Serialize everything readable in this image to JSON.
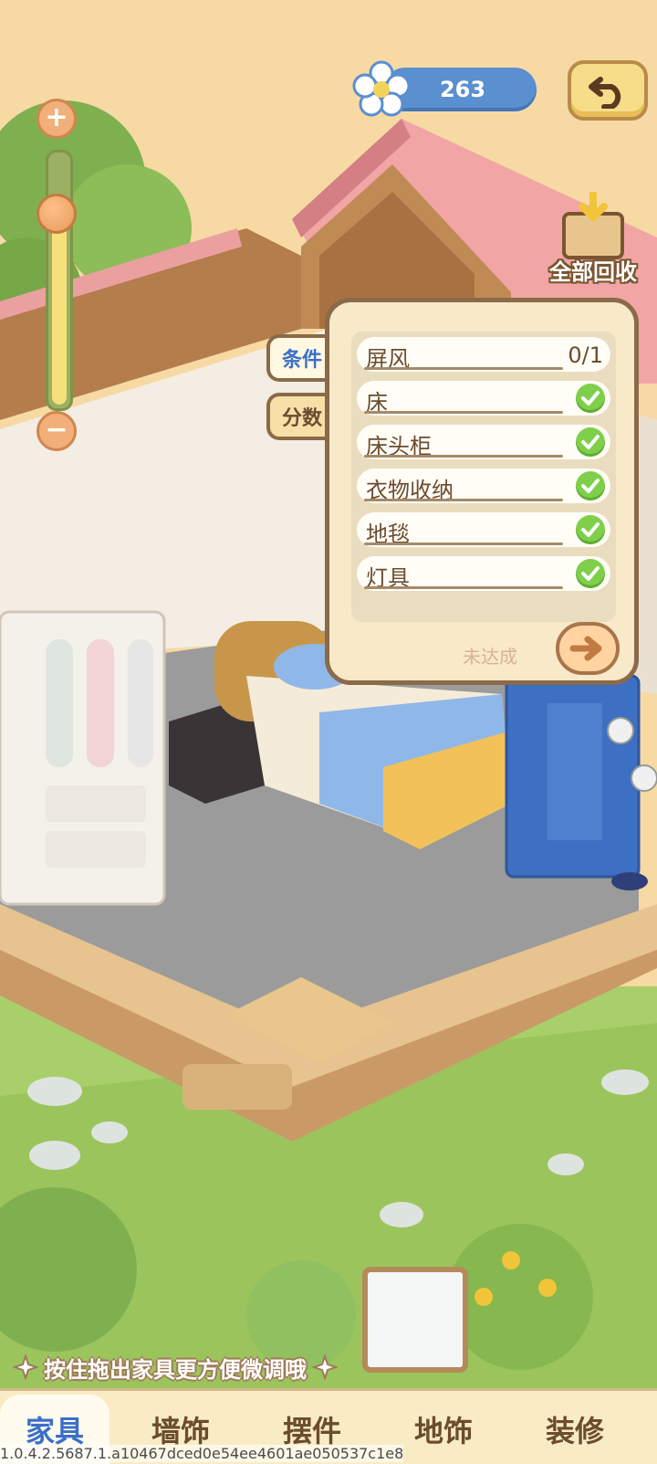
{
  "hud": {
    "currency_value": "263",
    "recycle_label": "全部回收"
  },
  "zoom": {
    "level": 0.75,
    "plus": "+",
    "minus": "−"
  },
  "panel": {
    "tabs": [
      "条件",
      "分数"
    ],
    "conditions": [
      {
        "name": "屏风",
        "progress": "0/1",
        "done": false
      },
      {
        "name": "床",
        "progress": "",
        "done": true
      },
      {
        "name": "床头柜",
        "progress": "",
        "done": true
      },
      {
        "name": "衣物收纳",
        "progress": "",
        "done": true
      },
      {
        "name": "地毯",
        "progress": "",
        "done": true
      },
      {
        "name": "灯具",
        "progress": "",
        "done": true
      }
    ],
    "status": "未达成"
  },
  "hint": "按住拖出家具更方便微调哦",
  "nav": {
    "items": [
      "家具",
      "墙饰",
      "摆件",
      "地饰",
      "装修"
    ],
    "active": "家具"
  },
  "version": "1.0.4.2.5687.1.a10467dced0e54ee4601ae050537c1e8",
  "colors": {
    "accent_blue": "#3b6fc8",
    "check_green": "#7fcf4b",
    "panel_border": "#8a6a48"
  }
}
